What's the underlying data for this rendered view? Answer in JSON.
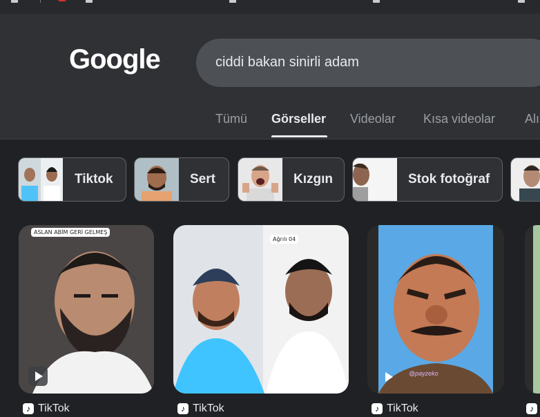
{
  "header": {
    "logo_text": "Google",
    "search": {
      "value": "ciddi bakan sinirli adam"
    }
  },
  "tabs": [
    {
      "label": "Tümü",
      "active": false
    },
    {
      "label": "Görseller",
      "active": true
    },
    {
      "label": "Videolar",
      "active": false
    },
    {
      "label": "Kısa videolar",
      "active": false
    },
    {
      "label": "Alı",
      "active": false
    }
  ],
  "chips": [
    {
      "label": "Tiktok"
    },
    {
      "label": "Sert"
    },
    {
      "label": "Kızgın"
    },
    {
      "label": "Stok fotoğraf"
    }
  ],
  "results": [
    {
      "source": "TikTok",
      "sticker": "ASLAN ABİM GERİ GELMEŞ",
      "has_play": true
    },
    {
      "source": "TikTok",
      "sticker": "Ağrılı 04",
      "has_play": false
    },
    {
      "source": "TikTok",
      "sticker": "@payzeko",
      "has_play": true
    },
    {
      "source": ""
    }
  ],
  "colors": {
    "background": "#202124",
    "header": "#303134",
    "search_box": "#4d5156",
    "text": "#e8eaed",
    "muted": "#9aa0a6"
  }
}
